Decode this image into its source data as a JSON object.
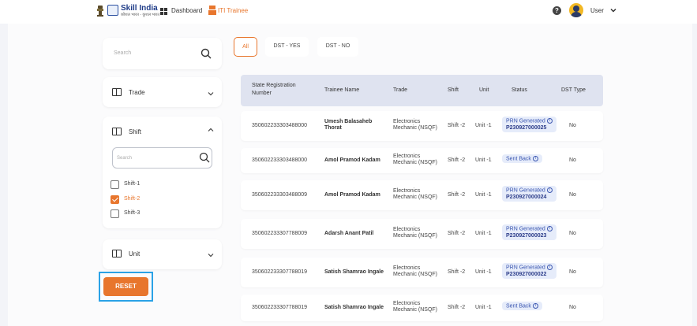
{
  "brand": {
    "title": "Skill India",
    "subtitle": "कौशल भारत - कुशल भारत"
  },
  "nav": {
    "dashboard": "Dashboard",
    "iti_trainee": "ITI Trainee"
  },
  "user": {
    "label": "User",
    "help": "?"
  },
  "sidebar": {
    "search_placeholder": "Search",
    "trade_label": "Trade",
    "shift_label": "Shift",
    "shift_search_placeholder": "Search",
    "shift_options": [
      {
        "label": "Shift-1",
        "checked": false
      },
      {
        "label": "Shift-2",
        "checked": true
      },
      {
        "label": "Shift-3",
        "checked": false
      }
    ],
    "unit_label": "Unit",
    "reset_label": "RESET"
  },
  "tabs": [
    {
      "label": "All",
      "active": true
    },
    {
      "label": "DST - YES",
      "active": false
    },
    {
      "label": "DST - NO",
      "active": false
    }
  ],
  "table": {
    "headers": [
      "State Registration Number",
      "Trainee Name",
      "Trade",
      "Shift",
      "Unit",
      "Status",
      "DST Type"
    ],
    "rows": [
      {
        "reg": "350602233303488000",
        "name": "Umesh Balasaheb Thorat",
        "trade": "Electronics Mechanic (NSQF)",
        "shift": "Shift -2",
        "unit": "Unit -1",
        "status": "PRN Generated",
        "prn": "P230927000025",
        "dst": "No"
      },
      {
        "reg": "350602233303488000",
        "name": "Amol Pramod Kadam",
        "trade": "Electronics Mechanic (NSQF)",
        "shift": "Shift -2",
        "unit": "Unit -1",
        "status": "Sent Back",
        "prn": "",
        "dst": "No"
      },
      {
        "reg": "350602233303488009",
        "name": "Amol Pramod Kadam",
        "trade": "Electronics Mechanic (NSQF)",
        "shift": "Shift -2",
        "unit": "Unit -1",
        "status": "PRN Generated",
        "prn": "P230927000024",
        "dst": "No"
      },
      {
        "reg": "350602233307788009",
        "name": "Adarsh Anant Patil",
        "trade": "Electronics Mechanic (NSQF)",
        "shift": "Shift -2",
        "unit": "Unit -1",
        "status": "PRN Generated",
        "prn": "P230927000023",
        "dst": "No"
      },
      {
        "reg": "350602233307788019",
        "name": "Satish Shamrao Ingale",
        "trade": "Electronics Mechanic (NSQF)",
        "shift": "Shift -2",
        "unit": "Unit -1",
        "status": "PRN Generated",
        "prn": "P230927000022",
        "dst": "No"
      },
      {
        "reg": "350602233307788019",
        "name": "Satish Shamrao Ingale",
        "trade": "Electronics Mechanic (NSQF)",
        "shift": "Shift -2",
        "unit": "Unit -1",
        "status": "Sent Back",
        "prn": "",
        "dst": "No"
      }
    ]
  },
  "colors": {
    "accent": "#e8762d",
    "status_bg": "#e6ecfa",
    "status_text": "#3a56b0",
    "header_bg": "#dfe3f0",
    "highlight_border": "#2aa2e6"
  }
}
